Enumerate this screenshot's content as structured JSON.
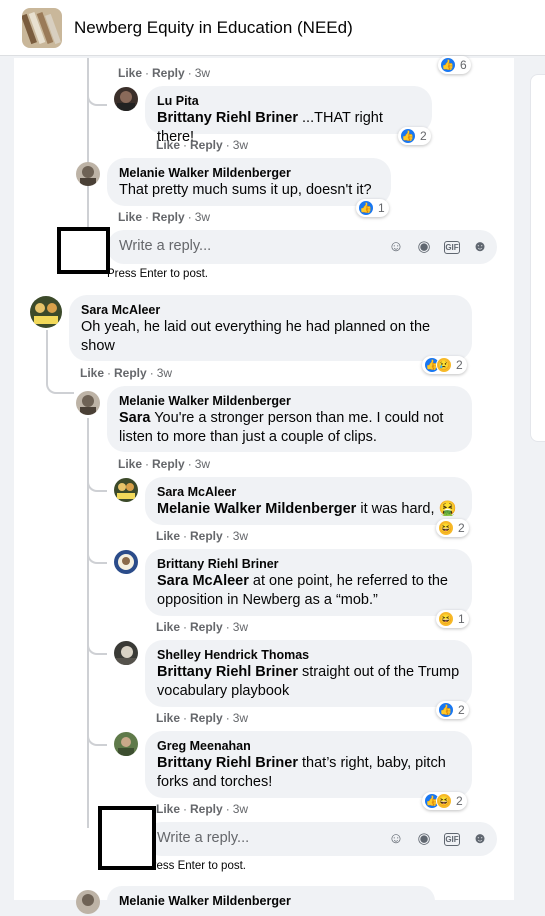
{
  "header": {
    "title": "Newberg Equity in Education (NEEd)"
  },
  "common": {
    "like": "Like",
    "reply": "Reply",
    "sep": "·"
  },
  "top_actions": {
    "time": "3w",
    "count": "6"
  },
  "comments": [
    {
      "name": "Lu Pita",
      "mention": "Brittany Riehl Briner",
      "text": " ...THAT right there!",
      "time": "3w",
      "count": "2"
    },
    {
      "name": "Melanie Walker Mildenberger",
      "text": "That pretty much sums it up, doesn't it?",
      "time": "3w",
      "count": "1"
    },
    {
      "name": "Sara McAleer",
      "text": "Oh yeah, he laid out everything he had planned on the show",
      "time": "3w",
      "count": "2"
    },
    {
      "name": "Melanie Walker Mildenberger",
      "mention": "Sara",
      "text": " You're a stronger person than me. I could not listen to more than just a couple of clips.",
      "time": "3w"
    },
    {
      "name": "Sara McAleer",
      "mention": "Melanie Walker Mildenberger",
      "text": " it was hard, 🤮",
      "time": "3w",
      "count": "2"
    },
    {
      "name": "Brittany Riehl Briner",
      "mention": "Sara McAleer",
      "text": " at one point, he referred to the opposition in Newberg as a “mob.”",
      "time": "3w",
      "count": "1"
    },
    {
      "name": "Shelley Hendrick Thomas",
      "mention": "Brittany Riehl Briner",
      "text": " straight out of the Trump vocabulary playbook",
      "time": "3w",
      "count": "2"
    },
    {
      "name": "Greg Meenahan",
      "mention": "Brittany Riehl Briner",
      "text": " that’s right, baby, pitch forks and torches!",
      "time": "3w",
      "count": "2"
    },
    {
      "name": "Melanie Walker Mildenberger"
    }
  ],
  "reply_boxes": [
    {
      "placeholder": "Write a reply...",
      "hint": "Press Enter to post."
    },
    {
      "placeholder": "Write a reply...",
      "hint": "Press Enter to post."
    }
  ],
  "icons": {
    "like": "thumbs-up",
    "haha": "laughing-face",
    "sad": "crying-face",
    "accent": "#1877f2"
  }
}
